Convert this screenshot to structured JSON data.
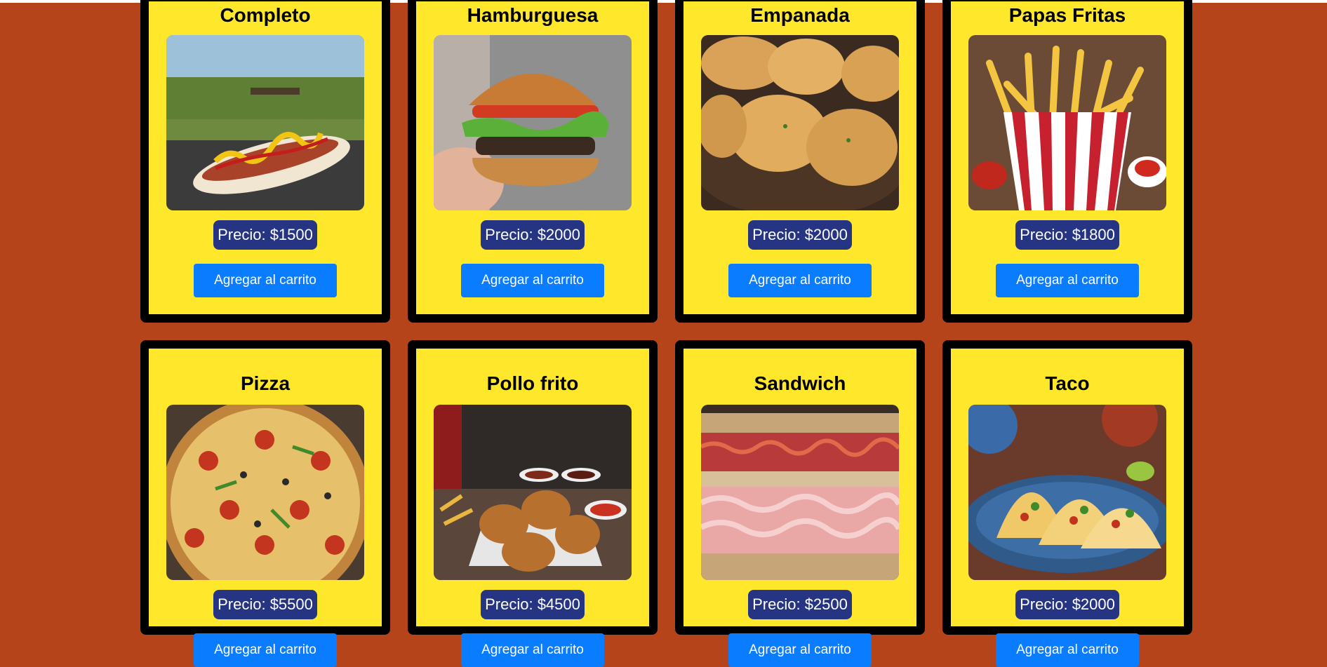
{
  "products": [
    {
      "name": "Completo",
      "price": "Precio: $1500",
      "button": "Agregar al carrito",
      "image": "hotdog-photo"
    },
    {
      "name": "Hamburguesa",
      "price": "Precio: $2000",
      "button": "Agregar al carrito",
      "image": "burger-photo"
    },
    {
      "name": "Empanada",
      "price": "Precio: $2000",
      "button": "Agregar al carrito",
      "image": "empanada-photo"
    },
    {
      "name": "Papas Fritas",
      "price": "Precio: $1800",
      "button": "Agregar al carrito",
      "image": "fries-photo"
    },
    {
      "name": "Pizza",
      "price": "Precio: $5500",
      "button": "Agregar al carrito",
      "image": "pizza-photo"
    },
    {
      "name": "Pollo frito",
      "price": "Precio: $4500",
      "button": "Agregar al carrito",
      "image": "fried-chicken-photo"
    },
    {
      "name": "Sandwich",
      "price": "Precio: $2500",
      "button": "Agregar al carrito",
      "image": "sandwich-photo"
    },
    {
      "name": "Taco",
      "price": "Precio: $2000",
      "button": "Agregar al carrito",
      "image": "taco-photo"
    }
  ],
  "colors": {
    "background": "#b5441a",
    "card": "#ffe82c",
    "card_border": "#000000",
    "price_badge": "#263583",
    "button": "#0a7cff"
  }
}
